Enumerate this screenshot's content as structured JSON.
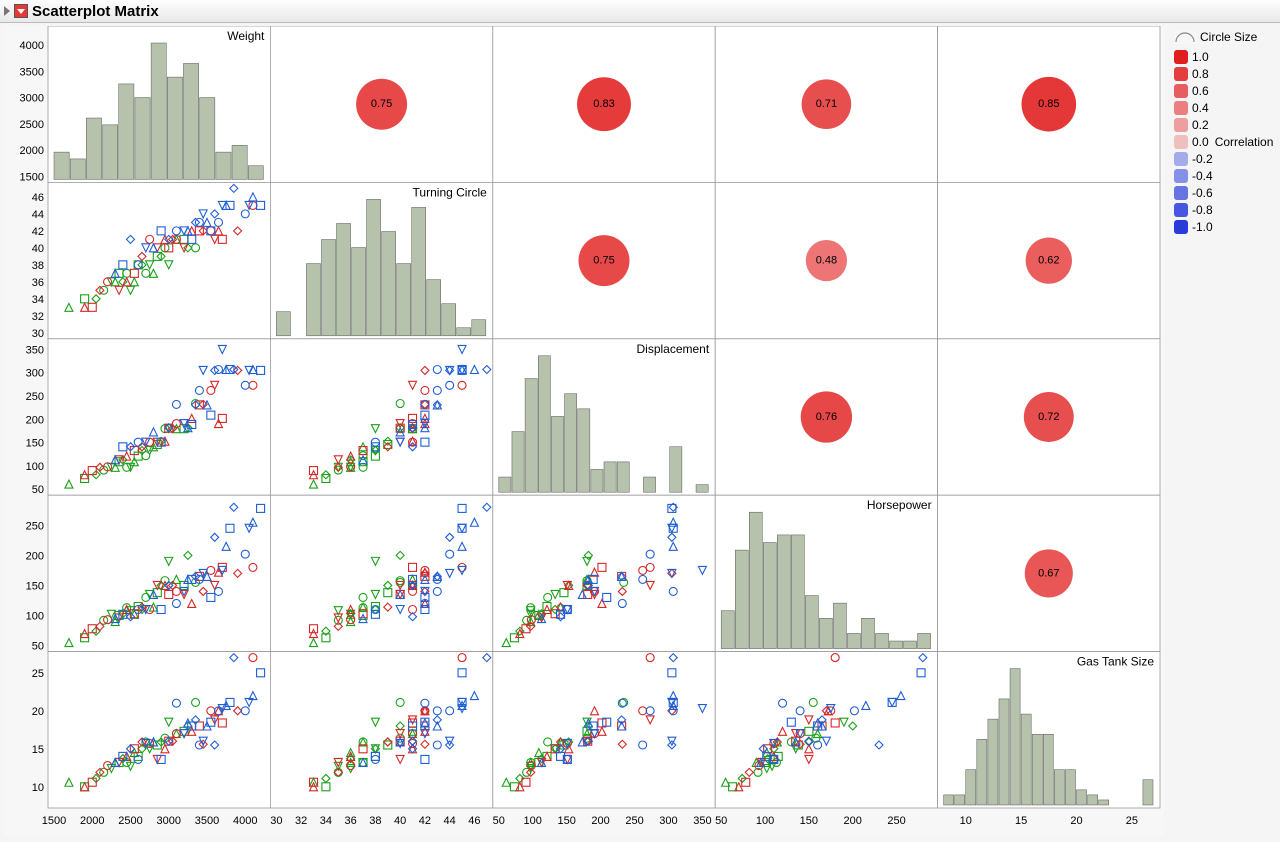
{
  "title": "Scatterplot Matrix",
  "variables": [
    "Weight",
    "Turning Circle",
    "Displacement",
    "Horsepower",
    "Gas Tank Size"
  ],
  "ranges": [
    {
      "min": 1500,
      "max": 4250
    },
    {
      "min": 30,
      "max": 47
    },
    {
      "min": 50,
      "max": 360
    },
    {
      "min": 50,
      "max": 290
    },
    {
      "min": 8,
      "max": 27
    }
  ],
  "axis_ticks": {
    "bottom": [
      [
        1500,
        2000,
        2500,
        3000,
        3500,
        4000
      ],
      [
        30,
        32,
        34,
        36,
        38,
        40,
        42,
        44,
        46
      ],
      [
        50,
        100,
        150,
        200,
        250,
        300,
        350
      ],
      [
        50,
        100,
        150,
        200,
        250
      ],
      [
        10,
        15,
        20,
        25
      ]
    ],
    "left": [
      [
        1500,
        2000,
        2500,
        3000,
        3500,
        4000
      ],
      [
        30,
        32,
        34,
        36,
        38,
        40,
        42,
        44,
        46
      ],
      [
        50,
        100,
        150,
        200,
        250,
        300,
        350
      ],
      [
        50,
        100,
        150,
        200,
        250
      ],
      [
        10,
        15,
        20,
        25
      ]
    ]
  },
  "histograms": [
    {
      "bins": [
        1600,
        1800,
        2000,
        2200,
        2400,
        2600,
        2800,
        3000,
        3200,
        3400,
        3600,
        3800,
        4000,
        4200
      ],
      "counts": [
        4,
        3,
        9,
        8,
        14,
        12,
        20,
        15,
        17,
        12,
        4,
        5,
        2
      ]
    },
    {
      "bins": [
        32,
        33,
        34,
        35,
        36,
        37,
        38,
        39,
        40,
        41,
        42,
        43,
        44,
        45,
        46
      ],
      "counts": [
        3,
        0,
        9,
        12,
        14,
        11,
        17,
        13,
        9,
        16,
        7,
        4,
        1,
        2
      ]
    },
    {
      "bins": [
        60,
        80,
        100,
        120,
        140,
        160,
        180,
        200,
        220,
        240,
        260,
        280,
        300,
        320,
        340,
        360
      ],
      "counts": [
        2,
        8,
        15,
        18,
        10,
        13,
        11,
        3,
        4,
        4,
        0,
        2,
        0,
        6,
        0,
        1
      ]
    },
    {
      "bins": [
        60,
        75,
        90,
        105,
        120,
        135,
        150,
        165,
        180,
        195,
        210,
        225,
        240,
        255,
        270,
        285
      ],
      "counts": [
        5,
        13,
        18,
        14,
        15,
        15,
        7,
        4,
        6,
        2,
        4,
        2,
        1,
        1,
        2
      ]
    },
    {
      "bins": [
        9,
        10,
        11,
        12,
        13,
        14,
        15,
        16,
        17,
        18,
        19,
        20,
        21,
        22,
        23,
        24,
        25,
        26,
        27
      ],
      "counts": [
        2,
        2,
        7,
        13,
        17,
        21,
        27,
        18,
        14,
        14,
        7,
        7,
        3,
        2,
        1,
        0,
        0,
        0,
        5
      ]
    }
  ],
  "correlations": [
    [
      1.0,
      0.75,
      0.83,
      0.71,
      0.85
    ],
    [
      0.75,
      1.0,
      0.75,
      0.48,
      0.62
    ],
    [
      0.83,
      0.75,
      1.0,
      0.76,
      0.72
    ],
    [
      0.71,
      0.48,
      0.76,
      1.0,
      0.67
    ],
    [
      0.85,
      0.62,
      0.72,
      0.67,
      1.0
    ]
  ],
  "legend": {
    "title": "Circle Size",
    "axis_label": "Correlation",
    "ticks": [
      1.0,
      0.8,
      0.6,
      0.4,
      0.2,
      0.0,
      -0.2,
      -0.4,
      -0.6,
      -0.8,
      -1.0
    ]
  },
  "chart_data": {
    "type": "scatterplot_matrix",
    "title": "Scatterplot Matrix",
    "variables": [
      "Weight",
      "Turning Circle",
      "Displacement",
      "Horsepower",
      "Gas Tank Size"
    ],
    "diagonal": "histogram",
    "upper_triangle": "correlation_circle",
    "lower_triangle": "scatterplot",
    "correlation_matrix": [
      [
        1.0,
        0.75,
        0.83,
        0.71,
        0.85
      ],
      [
        0.75,
        1.0,
        0.75,
        0.48,
        0.62
      ],
      [
        0.83,
        0.75,
        1.0,
        0.76,
        0.72
      ],
      [
        0.71,
        0.48,
        0.76,
        1.0,
        0.67
      ],
      [
        0.85,
        0.62,
        0.72,
        0.67,
        1.0
      ]
    ],
    "axis_ranges": {
      "Weight": [
        1500,
        4250
      ],
      "Turning Circle": [
        30,
        47
      ],
      "Displacement": [
        50,
        360
      ],
      "Horsepower": [
        50,
        290
      ],
      "Gas Tank Size": [
        8,
        27
      ]
    },
    "groups": [
      "green",
      "red",
      "blue"
    ],
    "observations": [
      {
        "g": 0,
        "Weight": 1695,
        "Turning Circle": 33,
        "Displacement": 61,
        "Horsepower": 55,
        "Gas Tank Size": 10.6
      },
      {
        "g": 0,
        "Weight": 1900,
        "Turning Circle": 34,
        "Displacement": 73,
        "Horsepower": 63,
        "Gas Tank Size": 10.0
      },
      {
        "g": 0,
        "Weight": 2050,
        "Turning Circle": 34,
        "Displacement": 81,
        "Horsepower": 74,
        "Gas Tank Size": 11.1
      },
      {
        "g": 0,
        "Weight": 2150,
        "Turning Circle": 35,
        "Displacement": 91,
        "Horsepower": 92,
        "Gas Tank Size": 11.9
      },
      {
        "g": 0,
        "Weight": 2250,
        "Turning Circle": 36,
        "Displacement": 97,
        "Horsepower": 102,
        "Gas Tank Size": 12.4
      },
      {
        "g": 0,
        "Weight": 2300,
        "Turning Circle": 36,
        "Displacement": 97,
        "Horsepower": 90,
        "Gas Tank Size": 13.2
      },
      {
        "g": 0,
        "Weight": 2350,
        "Turning Circle": 37,
        "Displacement": 109,
        "Horsepower": 100,
        "Gas Tank Size": 13.2
      },
      {
        "g": 0,
        "Weight": 2400,
        "Turning Circle": 36,
        "Displacement": 113,
        "Horsepower": 103,
        "Gas Tank Size": 13.7
      },
      {
        "g": 0,
        "Weight": 2450,
        "Turning Circle": 37,
        "Displacement": 97,
        "Horsepower": 113,
        "Gas Tank Size": 13.2
      },
      {
        "g": 0,
        "Weight": 2500,
        "Turning Circle": 35,
        "Displacement": 97,
        "Horsepower": 108,
        "Gas Tank Size": 12.7
      },
      {
        "g": 0,
        "Weight": 2550,
        "Turning Circle": 36,
        "Displacement": 109,
        "Horsepower": 102,
        "Gas Tank Size": 14.5
      },
      {
        "g": 0,
        "Weight": 2600,
        "Turning Circle": 38,
        "Displacement": 121,
        "Horsepower": 115,
        "Gas Tank Size": 14.0
      },
      {
        "g": 0,
        "Weight": 2650,
        "Turning Circle": 38,
        "Displacement": 133,
        "Horsepower": 110,
        "Gas Tank Size": 15.0
      },
      {
        "g": 0,
        "Weight": 2700,
        "Turning Circle": 37,
        "Displacement": 122,
        "Horsepower": 130,
        "Gas Tank Size": 15.9
      },
      {
        "g": 0,
        "Weight": 2750,
        "Turning Circle": 38,
        "Displacement": 133,
        "Horsepower": 135,
        "Gas Tank Size": 15.0
      },
      {
        "g": 0,
        "Weight": 2800,
        "Turning Circle": 37,
        "Displacement": 141,
        "Horsepower": 114,
        "Gas Tank Size": 15.9
      },
      {
        "g": 0,
        "Weight": 2850,
        "Turning Circle": 39,
        "Displacement": 146,
        "Horsepower": 138,
        "Gas Tank Size": 15.5
      },
      {
        "g": 0,
        "Weight": 2900,
        "Turning Circle": 39,
        "Displacement": 153,
        "Horsepower": 150,
        "Gas Tank Size": 15.9
      },
      {
        "g": 0,
        "Weight": 2950,
        "Turning Circle": 40,
        "Displacement": 180,
        "Horsepower": 158,
        "Gas Tank Size": 16.4
      },
      {
        "g": 0,
        "Weight": 3000,
        "Turning Circle": 38,
        "Displacement": 180,
        "Horsepower": 190,
        "Gas Tank Size": 18.5
      },
      {
        "g": 0,
        "Weight": 3100,
        "Turning Circle": 41,
        "Displacement": 180,
        "Horsepower": 160,
        "Gas Tank Size": 17.0
      },
      {
        "g": 0,
        "Weight": 3200,
        "Turning Circle": 41,
        "Displacement": 180,
        "Horsepower": 150,
        "Gas Tank Size": 17.3
      },
      {
        "g": 0,
        "Weight": 3250,
        "Turning Circle": 40,
        "Displacement": 182,
        "Horsepower": 200,
        "Gas Tank Size": 18.0
      },
      {
        "g": 0,
        "Weight": 3350,
        "Turning Circle": 40,
        "Displacement": 234,
        "Horsepower": 155,
        "Gas Tank Size": 21.1
      },
      {
        "g": 1,
        "Weight": 1900,
        "Turning Circle": 33,
        "Displacement": 81,
        "Horsepower": 70,
        "Gas Tank Size": 10.0
      },
      {
        "g": 1,
        "Weight": 2000,
        "Turning Circle": 33,
        "Displacement": 90,
        "Horsepower": 78,
        "Gas Tank Size": 10.6
      },
      {
        "g": 1,
        "Weight": 2100,
        "Turning Circle": 35,
        "Displacement": 97,
        "Horsepower": 82,
        "Gas Tank Size": 11.9
      },
      {
        "g": 1,
        "Weight": 2200,
        "Turning Circle": 36,
        "Displacement": 98,
        "Horsepower": 93,
        "Gas Tank Size": 12.8
      },
      {
        "g": 1,
        "Weight": 2350,
        "Turning Circle": 35,
        "Displacement": 113,
        "Horsepower": 96,
        "Gas Tank Size": 13.2
      },
      {
        "g": 1,
        "Weight": 2450,
        "Turning Circle": 36,
        "Displacement": 121,
        "Horsepower": 110,
        "Gas Tank Size": 14.0
      },
      {
        "g": 1,
        "Weight": 2550,
        "Turning Circle": 37,
        "Displacement": 133,
        "Horsepower": 103,
        "Gas Tank Size": 15.0
      },
      {
        "g": 1,
        "Weight": 2650,
        "Turning Circle": 39,
        "Displacement": 141,
        "Horsepower": 114,
        "Gas Tank Size": 15.9
      },
      {
        "g": 1,
        "Weight": 2750,
        "Turning Circle": 41,
        "Displacement": 151,
        "Horsepower": 110,
        "Gas Tank Size": 15.7
      },
      {
        "g": 1,
        "Weight": 2850,
        "Turning Circle": 40,
        "Displacement": 151,
        "Horsepower": 150,
        "Gas Tank Size": 13.6
      },
      {
        "g": 1,
        "Weight": 2950,
        "Turning Circle": 41,
        "Displacement": 153,
        "Horsepower": 150,
        "Gas Tank Size": 15.0
      },
      {
        "g": 1,
        "Weight": 3000,
        "Turning Circle": 40,
        "Displacement": 181,
        "Horsepower": 135,
        "Gas Tank Size": 16.0
      },
      {
        "g": 1,
        "Weight": 3050,
        "Turning Circle": 41,
        "Displacement": 180,
        "Horsepower": 150,
        "Gas Tank Size": 16.0
      },
      {
        "g": 1,
        "Weight": 3100,
        "Turning Circle": 41,
        "Displacement": 191,
        "Horsepower": 140,
        "Gas Tank Size": 17.0
      },
      {
        "g": 1,
        "Weight": 3200,
        "Turning Circle": 40,
        "Displacement": 191,
        "Horsepower": 135,
        "Gas Tank Size": 17.0
      },
      {
        "g": 1,
        "Weight": 3300,
        "Turning Circle": 42,
        "Displacement": 202,
        "Horsepower": 120,
        "Gas Tank Size": 17.3
      },
      {
        "g": 1,
        "Weight": 3400,
        "Turning Circle": 42,
        "Displacement": 231,
        "Horsepower": 165,
        "Gas Tank Size": 18.0
      },
      {
        "g": 1,
        "Weight": 3450,
        "Turning Circle": 42,
        "Displacement": 232,
        "Horsepower": 140,
        "Gas Tank Size": 15.6
      },
      {
        "g": 1,
        "Weight": 3550,
        "Turning Circle": 42,
        "Displacement": 262,
        "Horsepower": 175,
        "Gas Tank Size": 20.0
      },
      {
        "g": 1,
        "Weight": 3600,
        "Turning Circle": 41,
        "Displacement": 273,
        "Horsepower": 150,
        "Gas Tank Size": 18.8
      },
      {
        "g": 1,
        "Weight": 3650,
        "Turning Circle": 42,
        "Displacement": 191,
        "Horsepower": 172,
        "Gas Tank Size": 20.0
      },
      {
        "g": 1,
        "Weight": 3700,
        "Turning Circle": 41,
        "Displacement": 202,
        "Horsepower": 180,
        "Gas Tank Size": 18.4
      },
      {
        "g": 1,
        "Weight": 3900,
        "Turning Circle": 42,
        "Displacement": 305,
        "Horsepower": 170,
        "Gas Tank Size": 20.0
      },
      {
        "g": 1,
        "Weight": 4100,
        "Turning Circle": 45,
        "Displacement": 273,
        "Horsepower": 180,
        "Gas Tank Size": 27.0
      },
      {
        "g": 2,
        "Weight": 2300,
        "Turning Circle": 37,
        "Displacement": 113,
        "Horsepower": 95,
        "Gas Tank Size": 13.2
      },
      {
        "g": 2,
        "Weight": 2400,
        "Turning Circle": 38,
        "Displacement": 141,
        "Horsepower": 102,
        "Gas Tank Size": 14.0
      },
      {
        "g": 2,
        "Weight": 2500,
        "Turning Circle": 41,
        "Displacement": 141,
        "Horsepower": 98,
        "Gas Tank Size": 15.0
      },
      {
        "g": 2,
        "Weight": 2600,
        "Turning Circle": 38,
        "Displacement": 151,
        "Horsepower": 110,
        "Gas Tank Size": 13.6
      },
      {
        "g": 2,
        "Weight": 2700,
        "Turning Circle": 40,
        "Displacement": 151,
        "Horsepower": 110,
        "Gas Tank Size": 15.7
      },
      {
        "g": 2,
        "Weight": 2800,
        "Turning Circle": 40,
        "Displacement": 173,
        "Horsepower": 135,
        "Gas Tank Size": 15.9
      },
      {
        "g": 2,
        "Weight": 2900,
        "Turning Circle": 42,
        "Displacement": 151,
        "Horsepower": 110,
        "Gas Tank Size": 13.6
      },
      {
        "g": 2,
        "Weight": 3000,
        "Turning Circle": 41,
        "Displacement": 182,
        "Horsepower": 150,
        "Gas Tank Size": 16.0
      },
      {
        "g": 2,
        "Weight": 3100,
        "Turning Circle": 42,
        "Displacement": 232,
        "Horsepower": 120,
        "Gas Tank Size": 21.0
      },
      {
        "g": 2,
        "Weight": 3200,
        "Turning Circle": 42,
        "Displacement": 191,
        "Horsepower": 140,
        "Gas Tank Size": 17.0
      },
      {
        "g": 2,
        "Weight": 3250,
        "Turning Circle": 42,
        "Displacement": 182,
        "Horsepower": 160,
        "Gas Tank Size": 18.4
      },
      {
        "g": 2,
        "Weight": 3300,
        "Turning Circle": 41,
        "Displacement": 189,
        "Horsepower": 160,
        "Gas Tank Size": 18.0
      },
      {
        "g": 2,
        "Weight": 3350,
        "Turning Circle": 43,
        "Displacement": 231,
        "Horsepower": 165,
        "Gas Tank Size": 18.8
      },
      {
        "g": 2,
        "Weight": 3400,
        "Turning Circle": 43,
        "Displacement": 262,
        "Horsepower": 160,
        "Gas Tank Size": 15.5
      },
      {
        "g": 2,
        "Weight": 3450,
        "Turning Circle": 44,
        "Displacement": 305,
        "Horsepower": 170,
        "Gas Tank Size": 16.0
      },
      {
        "g": 2,
        "Weight": 3500,
        "Turning Circle": 43,
        "Displacement": 231,
        "Horsepower": 165,
        "Gas Tank Size": 18.0
      },
      {
        "g": 2,
        "Weight": 3550,
        "Turning Circle": 42,
        "Displacement": 209,
        "Horsepower": 130,
        "Gas Tank Size": 18.5
      },
      {
        "g": 2,
        "Weight": 3600,
        "Turning Circle": 44,
        "Displacement": 305,
        "Horsepower": 230,
        "Gas Tank Size": 15.5
      },
      {
        "g": 2,
        "Weight": 3650,
        "Turning Circle": 43,
        "Displacement": 307,
        "Horsepower": 140,
        "Gas Tank Size": 20.0
      },
      {
        "g": 2,
        "Weight": 3700,
        "Turning Circle": 45,
        "Displacement": 350,
        "Horsepower": 175,
        "Gas Tank Size": 20.3
      },
      {
        "g": 2,
        "Weight": 3750,
        "Turning Circle": 45,
        "Displacement": 307,
        "Horsepower": 215,
        "Gas Tank Size": 20.7
      },
      {
        "g": 2,
        "Weight": 3800,
        "Turning Circle": 45,
        "Displacement": 307,
        "Horsepower": 245,
        "Gas Tank Size": 21.1
      },
      {
        "g": 2,
        "Weight": 3850,
        "Turning Circle": 47,
        "Displacement": 307,
        "Horsepower": 280,
        "Gas Tank Size": 27.0
      },
      {
        "g": 2,
        "Weight": 4000,
        "Turning Circle": 44,
        "Displacement": 273,
        "Horsepower": 202,
        "Gas Tank Size": 20.0
      },
      {
        "g": 2,
        "Weight": 4050,
        "Turning Circle": 45,
        "Displacement": 305,
        "Horsepower": 245,
        "Gas Tank Size": 21.1
      },
      {
        "g": 2,
        "Weight": 4100,
        "Turning Circle": 46,
        "Displacement": 307,
        "Horsepower": 255,
        "Gas Tank Size": 22.0
      },
      {
        "g": 2,
        "Weight": 4200,
        "Turning Circle": 45,
        "Displacement": 305,
        "Horsepower": 278,
        "Gas Tank Size": 25.0
      }
    ]
  }
}
